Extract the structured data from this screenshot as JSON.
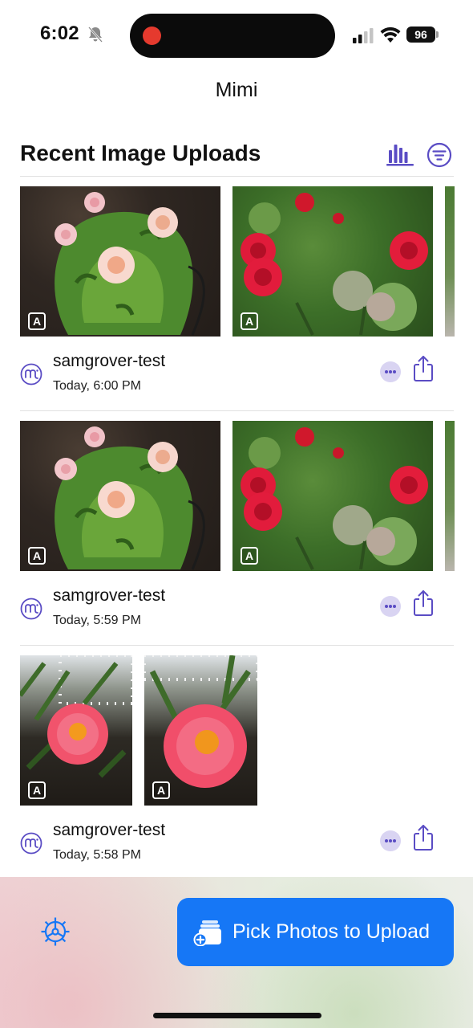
{
  "status_bar": {
    "time": "6:02",
    "battery": "96"
  },
  "app_title": "Mimi",
  "section": {
    "title": "Recent Image Uploads"
  },
  "uploads": [
    {
      "user": "samgrover-test",
      "date": "Today, 6:00 PM"
    },
    {
      "user": "samgrover-test",
      "date": "Today, 5:59 PM"
    },
    {
      "user": "samgrover-test",
      "date": "Today, 5:58 PM"
    }
  ],
  "ai_badge": "A",
  "upload_button": {
    "label": "Pick Photos to Upload"
  },
  "icons": {
    "bell": "bell-slash-icon",
    "signal": "cellular-signal-icon",
    "wifi": "wifi-icon",
    "chart": "bar-chart-icon",
    "filter": "filter-icon",
    "logo": "mimi-logo-icon",
    "more": "ellipsis-icon",
    "share": "share-icon",
    "settings": "gear-icon",
    "photos": "photo-stack-add-icon"
  },
  "colors": {
    "accent": "#5a4cc4",
    "primary": "#1677f6"
  }
}
